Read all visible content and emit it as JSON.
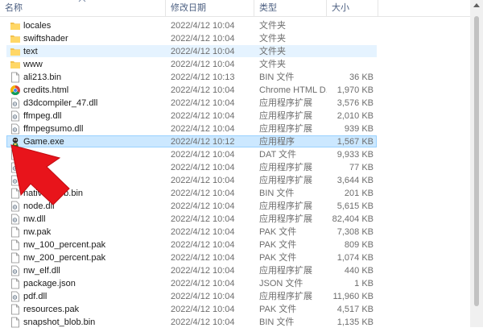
{
  "columns": {
    "name": "名称",
    "date": "修改日期",
    "type": "类型",
    "size": "大小"
  },
  "files": [
    {
      "name": "locales",
      "date": "2022/4/12 10:04",
      "type": "文件夹",
      "size": "",
      "icon": "folder-icon"
    },
    {
      "name": "swiftshader",
      "date": "2022/4/12 10:04",
      "type": "文件夹",
      "size": "",
      "icon": "folder-icon"
    },
    {
      "name": "text",
      "date": "2022/4/12 10:04",
      "type": "文件夹",
      "size": "",
      "icon": "folder-icon",
      "state": "hover"
    },
    {
      "name": "www",
      "date": "2022/4/12 10:04",
      "type": "文件夹",
      "size": "",
      "icon": "folder-icon"
    },
    {
      "name": "ali213.bin",
      "date": "2022/4/12 10:13",
      "type": "BIN 文件",
      "size": "36 KB",
      "icon": "file-icon"
    },
    {
      "name": "credits.html",
      "date": "2022/4/12 10:04",
      "type": "Chrome HTML D...",
      "size": "1,970 KB",
      "icon": "chrome-icon"
    },
    {
      "name": "d3dcompiler_47.dll",
      "date": "2022/4/12 10:04",
      "type": "应用程序扩展",
      "size": "3,576 KB",
      "icon": "dll-icon"
    },
    {
      "name": "ffmpeg.dll",
      "date": "2022/4/12 10:04",
      "type": "应用程序扩展",
      "size": "2,010 KB",
      "icon": "dll-icon"
    },
    {
      "name": "ffmpegsumo.dll",
      "date": "2022/4/12 10:04",
      "type": "应用程序扩展",
      "size": "939 KB",
      "icon": "dll-icon"
    },
    {
      "name": "Game.exe",
      "date": "2022/4/12 10:12",
      "type": "应用程序",
      "size": "1,567 KB",
      "icon": "game-exe-icon",
      "state": "selected"
    },
    {
      "name": "i      t",
      "date": "2022/4/12 10:04",
      "type": "DAT 文件",
      "size": "9,933 KB",
      "icon": "file-icon"
    },
    {
      "name": "",
      "date": "2022/4/12 10:04",
      "type": "应用程序扩展",
      "size": "77 KB",
      "icon": "dll-icon"
    },
    {
      "name": "libG     dll",
      "date": "2022/4/12 10:04",
      "type": "应用程序扩展",
      "size": "3,644 KB",
      "icon": "dll-icon"
    },
    {
      "name": "native_blob.bin",
      "date": "2022/4/12 10:04",
      "type": "BIN 文件",
      "size": "201 KB",
      "icon": "file-icon"
    },
    {
      "name": "node.dll",
      "date": "2022/4/12 10:04",
      "type": "应用程序扩展",
      "size": "5,615 KB",
      "icon": "dll-icon"
    },
    {
      "name": "nw.dll",
      "date": "2022/4/12 10:04",
      "type": "应用程序扩展",
      "size": "82,404 KB",
      "icon": "dll-icon"
    },
    {
      "name": "nw.pak",
      "date": "2022/4/12 10:04",
      "type": "PAK 文件",
      "size": "7,308 KB",
      "icon": "file-icon"
    },
    {
      "name": "nw_100_percent.pak",
      "date": "2022/4/12 10:04",
      "type": "PAK 文件",
      "size": "809 KB",
      "icon": "file-icon"
    },
    {
      "name": "nw_200_percent.pak",
      "date": "2022/4/12 10:04",
      "type": "PAK 文件",
      "size": "1,074 KB",
      "icon": "file-icon"
    },
    {
      "name": "nw_elf.dll",
      "date": "2022/4/12 10:04",
      "type": "应用程序扩展",
      "size": "440 KB",
      "icon": "dll-icon"
    },
    {
      "name": "package.json",
      "date": "2022/4/12 10:04",
      "type": "JSON 文件",
      "size": "1 KB",
      "icon": "file-icon"
    },
    {
      "name": "pdf.dll",
      "date": "2022/4/12 10:04",
      "type": "应用程序扩展",
      "size": "11,960 KB",
      "icon": "dll-icon"
    },
    {
      "name": "resources.pak",
      "date": "2022/4/12 10:04",
      "type": "PAK 文件",
      "size": "4,517 KB",
      "icon": "file-icon"
    },
    {
      "name": "snapshot_blob.bin",
      "date": "2022/4/12 10:04",
      "type": "BIN 文件",
      "size": "1,135 KB",
      "icon": "file-icon"
    }
  ],
  "colors": {
    "selected": "#cce8ff",
    "hover": "#e5f3ff",
    "folder": "#f2c14e",
    "arrow": "#e8141b"
  }
}
